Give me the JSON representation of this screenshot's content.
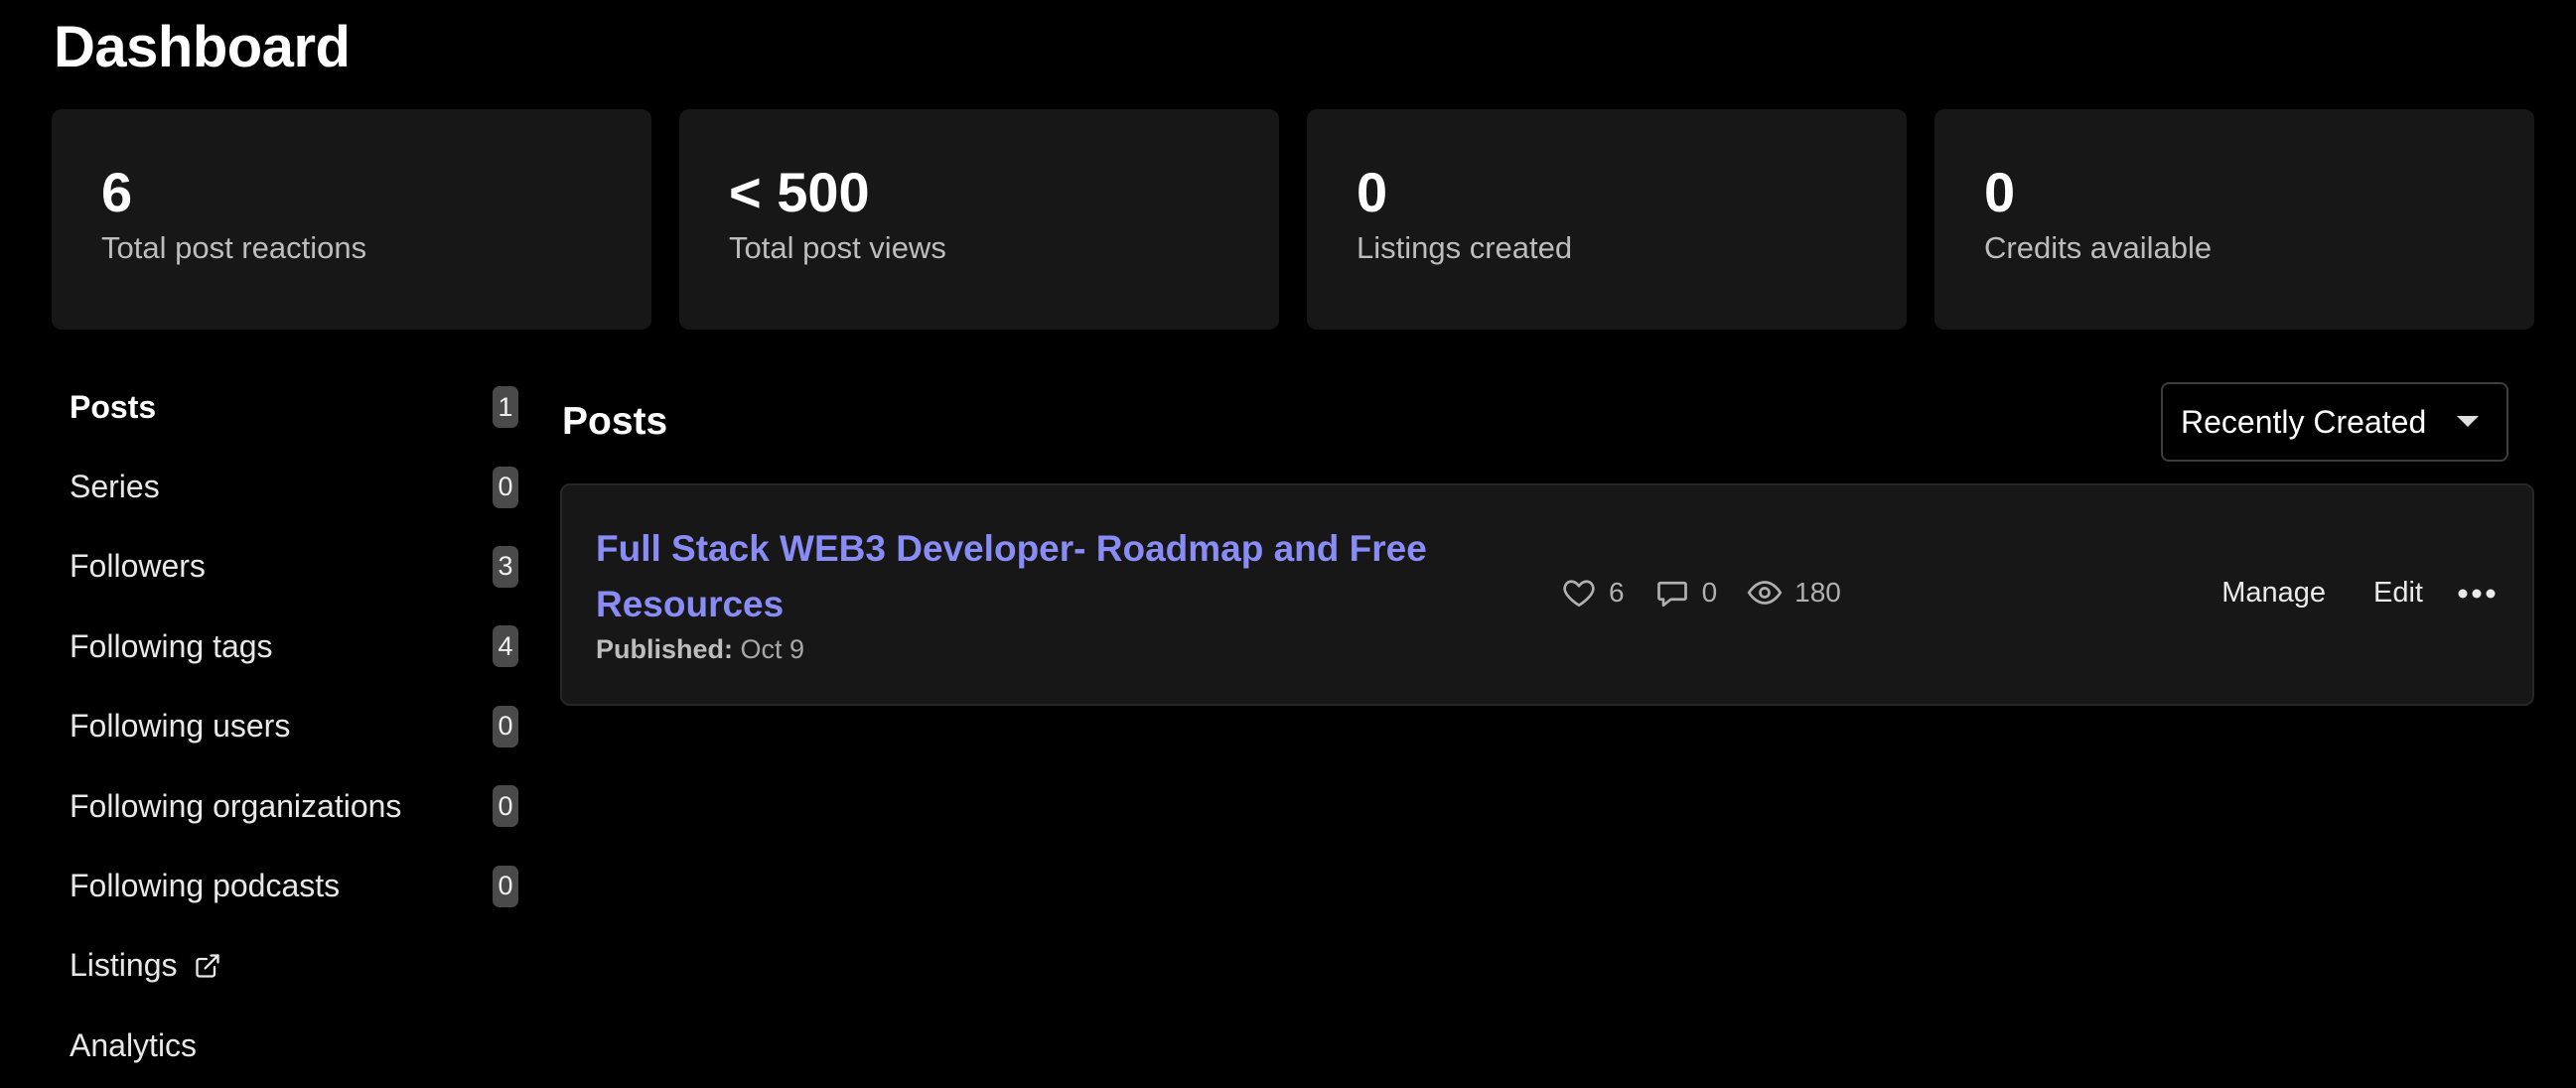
{
  "page": {
    "title": "Dashboard"
  },
  "stats": [
    {
      "value": "6",
      "label": "Total post reactions"
    },
    {
      "value": "< 500",
      "label": "Total post views"
    },
    {
      "value": "0",
      "label": "Listings created"
    },
    {
      "value": "0",
      "label": "Credits available"
    }
  ],
  "sidebar": {
    "items": [
      {
        "label": "Posts",
        "count": "1"
      },
      {
        "label": "Series",
        "count": "0"
      },
      {
        "label": "Followers",
        "count": "3"
      },
      {
        "label": "Following tags",
        "count": "4"
      },
      {
        "label": "Following users",
        "count": "0"
      },
      {
        "label": "Following organizations",
        "count": "0"
      },
      {
        "label": "Following podcasts",
        "count": "0"
      },
      {
        "label": "Listings",
        "icon": "external-link-icon"
      },
      {
        "label": "Analytics"
      }
    ]
  },
  "posts": {
    "heading": "Posts",
    "sort_selected": "Recently Created",
    "items": [
      {
        "title": "Full Stack WEB3 Developer- Roadmap and Free Resources",
        "published_label": "Published:",
        "published_date": "Oct 9",
        "reactions": "6",
        "comments": "0",
        "views": "180",
        "manage_label": "Manage",
        "edit_label": "Edit"
      }
    ]
  },
  "colors": {
    "background": "#000000",
    "card": "#171717",
    "link": "#8a8cf5",
    "badge": "#4a4a4a"
  }
}
